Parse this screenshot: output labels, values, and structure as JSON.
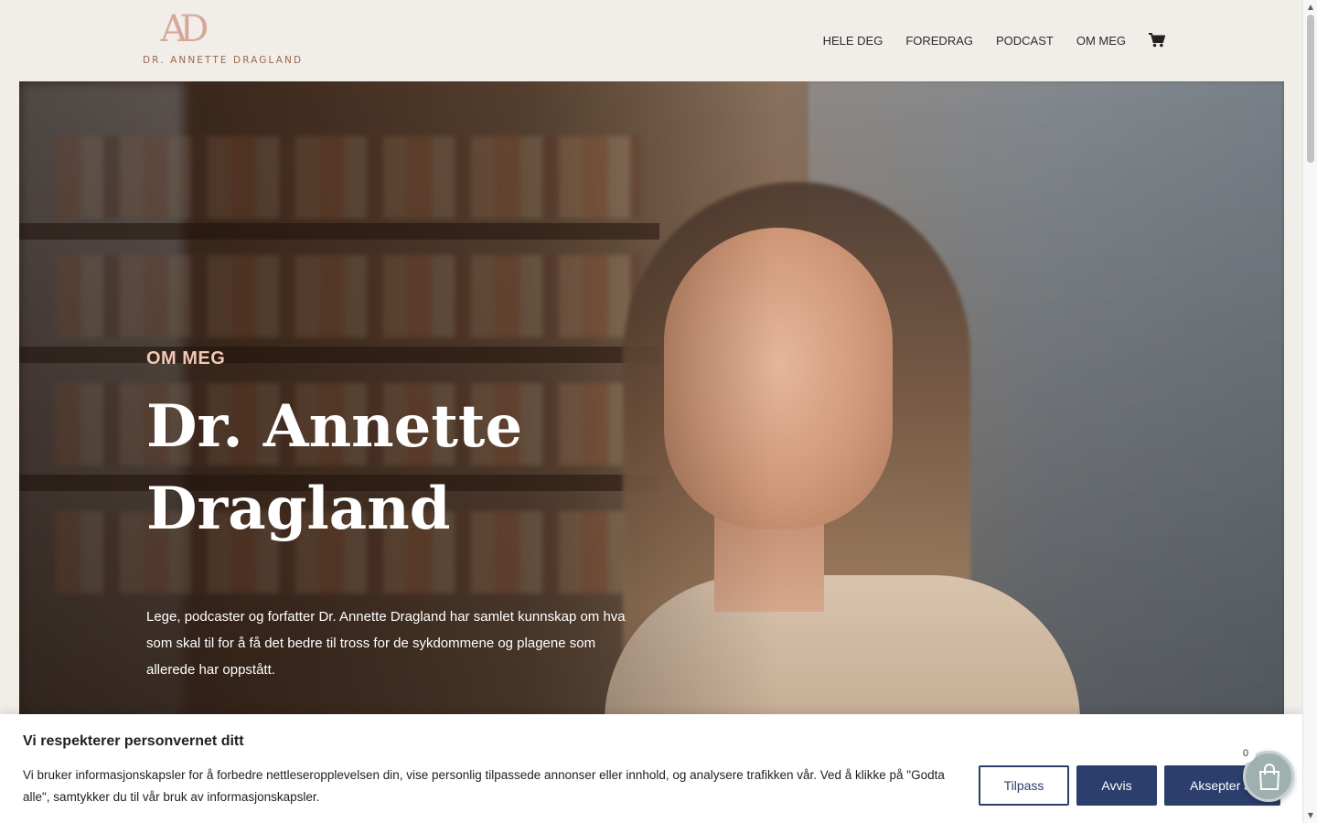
{
  "header": {
    "logo_mark": "AD",
    "logo_text": "DR. ANNETTE DRAGLAND",
    "nav": [
      {
        "label": "HELE DEG"
      },
      {
        "label": "FOREDRAG"
      },
      {
        "label": "PODCAST"
      },
      {
        "label": "OM MEG"
      }
    ],
    "cart_icon": "shopping-cart-icon"
  },
  "hero": {
    "kicker": "OM MEG",
    "title_line1": "Dr. Annette",
    "title_line2": "Dragland",
    "description": "Lege, podcaster og forfatter Dr. Annette Dragland har samlet kunnskap om hva som skal til for å få det bedre til tross for de sykdommene og plagene som allerede har oppstått."
  },
  "cookie_banner": {
    "title": "Vi respekterer personvernet ditt",
    "text": "Vi bruker informasjonskapsler for å forbedre nettleseropplevelsen din, vise personlig tilpassede annonser eller innhold, og analysere trafikken vår. Ved å klikke på \"Godta alle\", samtykker du til vår bruk av informasjonskapsler.",
    "customize_label": "Tilpass",
    "reject_label": "Avvis",
    "accept_label": "Aksepter a"
  },
  "floating_cart": {
    "count": "0",
    "icon": "shopping-bag-icon"
  },
  "colors": {
    "accent": "#2b3e6c",
    "kicker": "#f2c7b4",
    "logo_mark": "#d7a79a",
    "logo_text": "#9a6a49",
    "background": "#f1ede9"
  }
}
